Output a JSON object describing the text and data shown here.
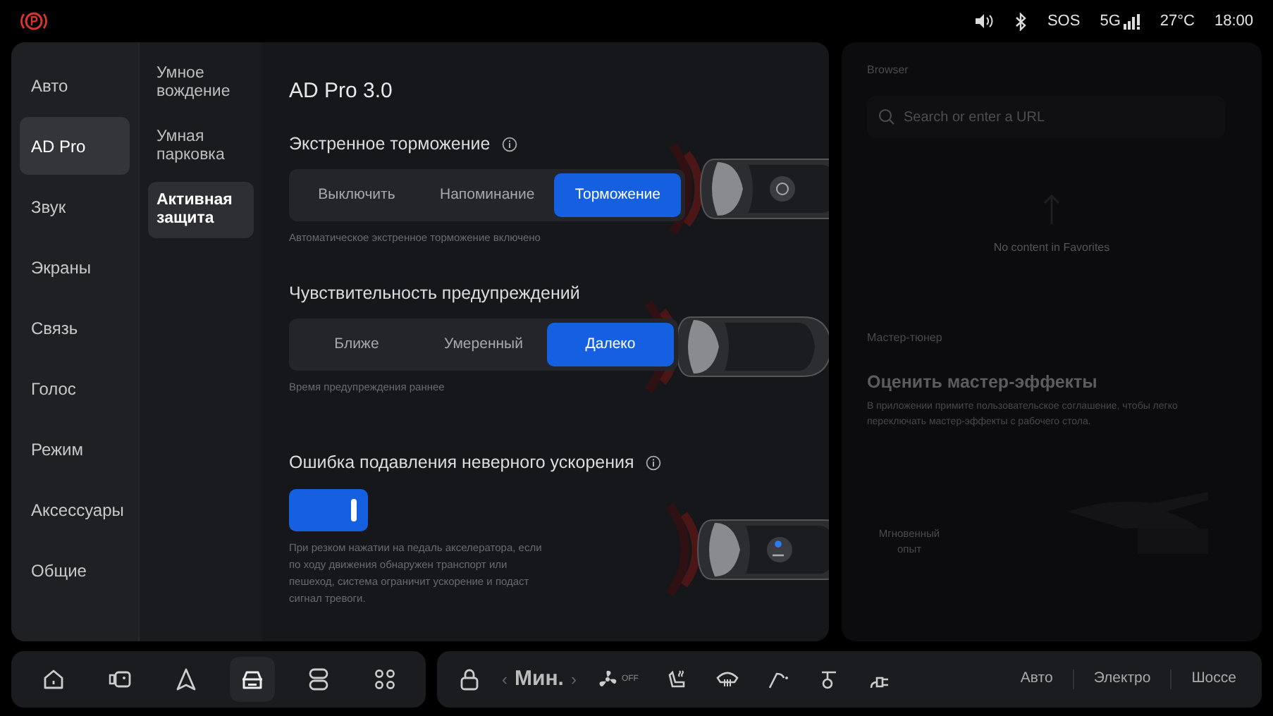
{
  "status_bar": {
    "items": [
      "SOS",
      "5G",
      "27°C",
      "18:00"
    ]
  },
  "sidebar": {
    "items": [
      {
        "label": "Авто",
        "selected": false
      },
      {
        "label": "AD Pro",
        "selected": true
      },
      {
        "label": "Звук",
        "selected": false
      },
      {
        "label": "Экраны",
        "selected": false
      },
      {
        "label": "Связь",
        "selected": false
      },
      {
        "label": "Голос",
        "selected": false
      },
      {
        "label": "Режим",
        "selected": false
      },
      {
        "label": "Аксессуары",
        "selected": false
      },
      {
        "label": "Общие",
        "selected": false
      }
    ]
  },
  "submenu": {
    "items": [
      {
        "label": "Умное вождение",
        "selected": false
      },
      {
        "label": "Умная парковка",
        "selected": false
      },
      {
        "label": "Активная защита",
        "selected": true
      }
    ]
  },
  "content": {
    "title": "AD Pro 3.0",
    "sections": [
      {
        "kind": "segmented",
        "title": "Экстренное торможение",
        "info": true,
        "options": [
          {
            "label": "Выключить",
            "selected": false
          },
          {
            "label": "Напоминание",
            "selected": false
          },
          {
            "label": "Торможение",
            "selected": true
          }
        ],
        "description": "Автоматическое экстренное торможение включено"
      },
      {
        "kind": "segmented",
        "title": "Чувствительность предупреждений",
        "info": false,
        "options": [
          {
            "label": "Ближе",
            "selected": false
          },
          {
            "label": "Умеренный",
            "selected": false
          },
          {
            "label": "Далеко",
            "selected": true
          }
        ],
        "description": "Время предупреждения раннее"
      },
      {
        "kind": "toggle",
        "title": "Ошибка подавления неверного ускорения",
        "info": true,
        "on": true,
        "description": "При резком нажатии на педаль акселератора, если по ходу движения обнаружен транспорт или пешеход, система ограничит ускорение и подаст сигнал тревоги."
      }
    ]
  },
  "right_panel": {
    "browser": {
      "title": "Browser",
      "search": {
        "placeholder": "Search or enter a URL"
      },
      "empty_text": "No content in Favorites"
    },
    "tuner": {
      "label": "Мастер-тюнер",
      "heading": "Оценить мастер-эффекты",
      "description": "В приложении примите пользовательское соглашение, чтобы легко переключать мастер-эффекты с рабочего стола.",
      "button": "Мгновенный опыт"
    }
  },
  "dock": {
    "apps": [
      {
        "kind": "home",
        "selected": false
      },
      {
        "kind": "camera",
        "selected": false
      },
      {
        "kind": "navigation",
        "selected": false
      },
      {
        "kind": "car",
        "selected": true
      },
      {
        "kind": "toggles",
        "selected": false
      },
      {
        "kind": "apps",
        "selected": false
      }
    ],
    "climate": {
      "prev": "‹",
      "value": "Мин.",
      "next": "›",
      "fan_state": "OFF"
    },
    "modes": [
      {
        "label": "Авто"
      },
      {
        "label": "Электро"
      },
      {
        "label": "Шоссе"
      }
    ]
  }
}
